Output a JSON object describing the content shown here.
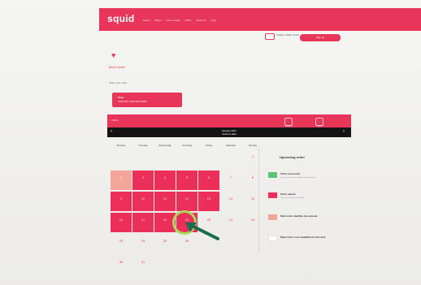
{
  "brand": {
    "logo": "squid",
    "accent": "#e8365a"
  },
  "nav": {
    "links": [
      "Home",
      "Shops",
      "How it works",
      "Offers",
      "About us",
      "Help"
    ]
  },
  "subheader": {
    "tickets_text": "Tickets / Seller Kiosk",
    "signup": "Sign up"
  },
  "section": {
    "title": "Meal Order",
    "label": "Order your meal"
  },
  "card": {
    "name": "Peter",
    "number": "TPS 0327 1234 5678 9007"
  },
  "calendar": {
    "back": "< Back",
    "icons": [
      "Calendar",
      "Orders"
    ],
    "month": "January 2017",
    "sub": "Select a date",
    "prev": "‹",
    "next": "›",
    "weekdays": [
      "Monday",
      "Tuesday",
      "Wednesday",
      "Thursday",
      "Friday",
      "Saturday",
      "Sunday"
    ],
    "days": [
      {
        "n": "",
        "r": 0,
        "c": 0,
        "s": "empty"
      },
      {
        "n": "",
        "r": 0,
        "c": 1,
        "s": "empty"
      },
      {
        "n": "",
        "r": 0,
        "c": 2,
        "s": "empty"
      },
      {
        "n": "",
        "r": 0,
        "c": 3,
        "s": "empty"
      },
      {
        "n": "",
        "r": 0,
        "c": 4,
        "s": "empty"
      },
      {
        "n": "",
        "r": 0,
        "c": 5,
        "s": "empty"
      },
      {
        "n": "1",
        "r": 0,
        "c": 6,
        "s": "plain"
      },
      {
        "n": "2",
        "r": 1,
        "c": 0,
        "s": "missed"
      },
      {
        "n": "3",
        "r": 1,
        "c": 1,
        "s": "filled"
      },
      {
        "n": "4",
        "r": 1,
        "c": 2,
        "s": "filled"
      },
      {
        "n": "5",
        "r": 1,
        "c": 3,
        "s": "filled"
      },
      {
        "n": "6",
        "r": 1,
        "c": 4,
        "s": "filled"
      },
      {
        "n": "7",
        "r": 1,
        "c": 5,
        "s": "plain"
      },
      {
        "n": "8",
        "r": 1,
        "c": 6,
        "s": "plain"
      },
      {
        "n": "9",
        "r": 2,
        "c": 0,
        "s": "filled"
      },
      {
        "n": "10",
        "r": 2,
        "c": 1,
        "s": "filled"
      },
      {
        "n": "11",
        "r": 2,
        "c": 2,
        "s": "filled"
      },
      {
        "n": "12",
        "r": 2,
        "c": 3,
        "s": "filled"
      },
      {
        "n": "13",
        "r": 2,
        "c": 4,
        "s": "filled"
      },
      {
        "n": "14",
        "r": 2,
        "c": 5,
        "s": "plain"
      },
      {
        "n": "15",
        "r": 2,
        "c": 6,
        "s": "plain"
      },
      {
        "n": "16",
        "r": 3,
        "c": 0,
        "s": "filled"
      },
      {
        "n": "17",
        "r": 3,
        "c": 1,
        "s": "filled"
      },
      {
        "n": "18",
        "r": 3,
        "c": 2,
        "s": "filled"
      },
      {
        "n": "19",
        "r": 3,
        "c": 3,
        "s": "filled"
      },
      {
        "n": "20",
        "r": 3,
        "c": 4,
        "s": "plain"
      },
      {
        "n": "21",
        "r": 3,
        "c": 5,
        "s": "plain"
      },
      {
        "n": "22",
        "r": 3,
        "c": 6,
        "s": "plain"
      },
      {
        "n": "23",
        "r": 4,
        "c": 0,
        "s": "plain"
      },
      {
        "n": "24",
        "r": 4,
        "c": 1,
        "s": "plain"
      },
      {
        "n": "25",
        "r": 4,
        "c": 2,
        "s": "plain"
      },
      {
        "n": "26",
        "r": 4,
        "c": 3,
        "s": "plain"
      },
      {
        "n": "",
        "r": 4,
        "c": 4,
        "s": "empty"
      },
      {
        "n": "",
        "r": 4,
        "c": 5,
        "s": "empty"
      },
      {
        "n": "",
        "r": 4,
        "c": 6,
        "s": "empty"
      },
      {
        "n": "30",
        "r": 5,
        "c": 0,
        "s": "plain"
      },
      {
        "n": "31",
        "r": 5,
        "c": 1,
        "s": "plain"
      }
    ]
  },
  "legend": {
    "title": "Upcoming order",
    "items": [
      {
        "label": "Order processed",
        "desc": "Your order has been accepted and is processed",
        "color": "#5cc27a"
      },
      {
        "label": "Order placed",
        "desc": "Your order is placed and editable",
        "color": "#ec2f58"
      },
      {
        "label": "Meal order deadline has passed",
        "desc": "",
        "color": "#f3a59a"
      },
      {
        "label": "Meal order is not available for this date",
        "desc": "",
        "color": "#ffffff"
      }
    ]
  }
}
